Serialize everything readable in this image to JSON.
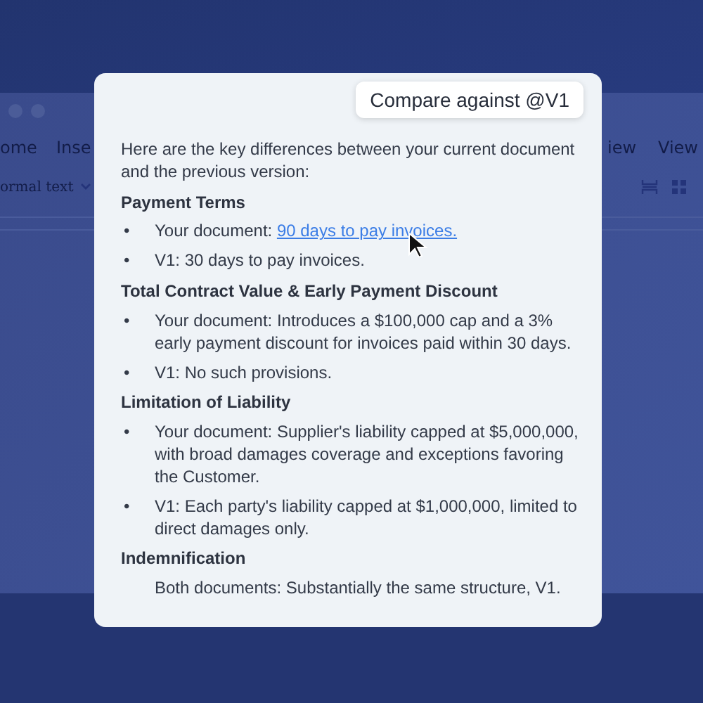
{
  "background_window": {
    "menu": [
      "ome",
      "Inse",
      "iew",
      "View"
    ],
    "style_dropdown": "ormal text"
  },
  "prompt": "Compare against @V1",
  "response": {
    "intro": "Here are the key differences between your current document and the previous version:",
    "sections": [
      {
        "heading": "Payment Terms",
        "items": [
          {
            "marker": "•",
            "text": "Your document: ",
            "link": "90 days to pay invoices."
          },
          {
            "marker": "•",
            "text": "V1: 30 days to pay invoices."
          }
        ]
      },
      {
        "heading": "Total Contract Value & Early Payment Discount",
        "items": [
          {
            "marker": "•",
            "text": "Your document: Introduces a $100,000 cap and a 3% early payment discount for invoices paid within 30 days."
          },
          {
            "marker": "•",
            "text": "V1: No such provisions."
          }
        ]
      },
      {
        "heading": "Limitation of Liability",
        "items": [
          {
            "marker": "•",
            "text": "Your document: Supplier's liability capped at $5,000,000, with broad damages coverage and exceptions favoring the Customer."
          },
          {
            "marker": "•",
            "text": "V1: Each party's liability capped at $1,000,000, limited to direct damages only."
          }
        ]
      },
      {
        "heading": "Indemnification",
        "items": [
          {
            "text": "Both documents: Substantially the same structure, V1."
          }
        ]
      }
    ]
  }
}
